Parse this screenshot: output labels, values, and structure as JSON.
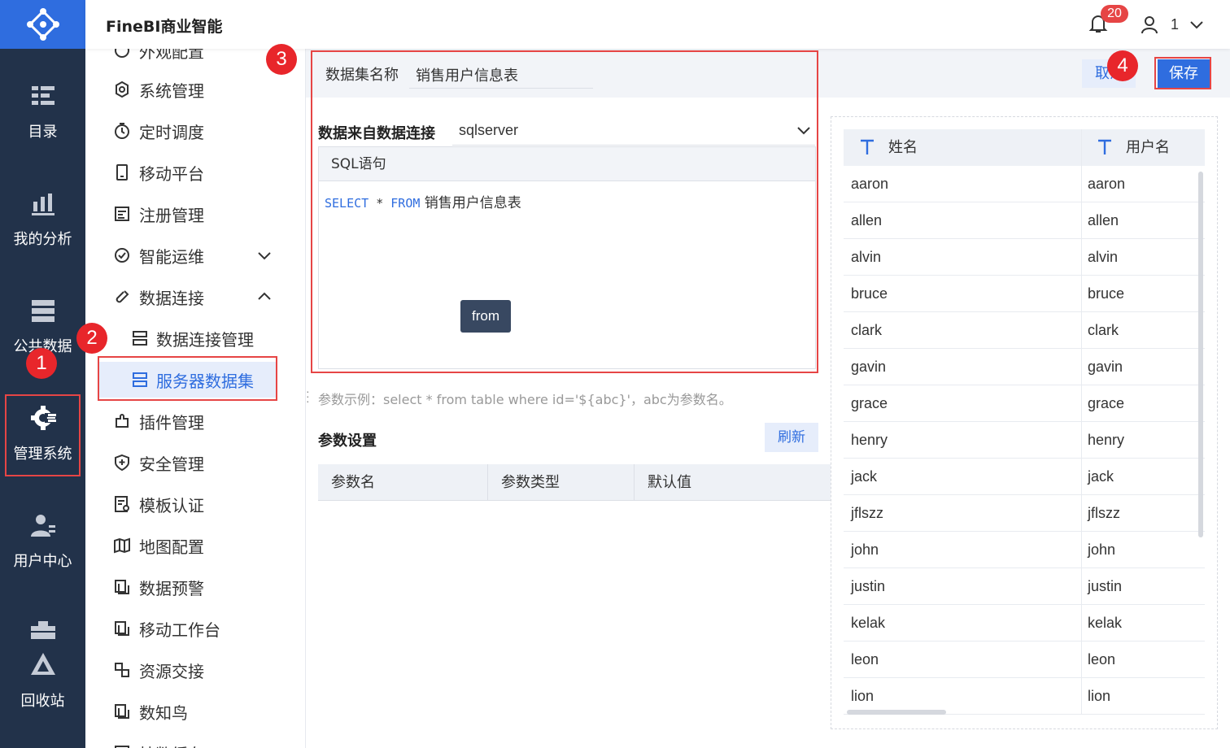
{
  "app": {
    "title": "FineBI商业智能"
  },
  "header": {
    "notification_count": "20",
    "user_name": "1"
  },
  "rail": {
    "items": [
      {
        "label": "目录",
        "icon": "catalog-icon"
      },
      {
        "label": "我的分析",
        "icon": "analysis-icon"
      },
      {
        "label": "公共数据",
        "icon": "public-data-icon"
      },
      {
        "label": "管理系统",
        "icon": "gear-icon",
        "active": true
      },
      {
        "label": "用户中心",
        "icon": "user-center-icon"
      },
      {
        "label": "",
        "icon": "toolbox-icon"
      },
      {
        "label": "回收站",
        "icon": "recycle-icon"
      }
    ]
  },
  "subnav": {
    "items": [
      {
        "label": "外观配置",
        "icon": "appearance-icon"
      },
      {
        "label": "系统管理",
        "icon": "settings-icon"
      },
      {
        "label": "定时调度",
        "icon": "timer-icon"
      },
      {
        "label": "移动平台",
        "icon": "mobile-icon"
      },
      {
        "label": "注册管理",
        "icon": "register-icon"
      },
      {
        "label": "智能运维",
        "icon": "ops-icon",
        "chevron": "down"
      },
      {
        "label": "数据连接",
        "icon": "link-icon",
        "chevron": "up"
      },
      {
        "label": "数据连接管理",
        "icon": "database-icon",
        "sub": true
      },
      {
        "label": "服务器数据集",
        "icon": "database-icon",
        "sub": true,
        "active": true
      },
      {
        "label": "插件管理",
        "icon": "plugin-icon"
      },
      {
        "label": "安全管理",
        "icon": "shield-icon"
      },
      {
        "label": "模板认证",
        "icon": "certificate-icon"
      },
      {
        "label": "地图配置",
        "icon": "map-icon"
      },
      {
        "label": "数据预警",
        "icon": "copy-icon"
      },
      {
        "label": "移动工作台",
        "icon": "copy-icon"
      },
      {
        "label": "资源交接",
        "icon": "exchange-icon"
      },
      {
        "label": "数知鸟",
        "icon": "copy-icon"
      },
      {
        "label": "抽数缓存",
        "icon": "cache-icon"
      }
    ]
  },
  "editor": {
    "name_label": "数据集名称",
    "name_value": "销售用户信息表",
    "cancel_label": "取消",
    "save_label": "保存",
    "connection_label": "数据来自数据连接",
    "connection_value": "sqlserver",
    "sql_header": "SQL语句",
    "sql": {
      "kw1": "SELECT",
      "star": " * ",
      "kw2": "FROM",
      "table": " 销售用户信息表"
    },
    "tooltip": "from",
    "hint": "参数示例：select * from table where id='${abc}'，abc为参数名。",
    "param_title": "参数设置",
    "refresh_label": "刷新",
    "param_columns": [
      "参数名",
      "参数类型",
      "默认值"
    ]
  },
  "preview": {
    "columns": [
      "姓名",
      "用户名"
    ],
    "rows": [
      [
        "aaron",
        "aaron"
      ],
      [
        "allen",
        "allen"
      ],
      [
        "alvin",
        "alvin"
      ],
      [
        "bruce",
        "bruce"
      ],
      [
        "clark",
        "clark"
      ],
      [
        "gavin",
        "gavin"
      ],
      [
        "grace",
        "grace"
      ],
      [
        "henry",
        "henry"
      ],
      [
        "jack",
        "jack"
      ],
      [
        "jflszz",
        "jflszz"
      ],
      [
        "john",
        "john"
      ],
      [
        "justin",
        "justin"
      ],
      [
        "kelak",
        "kelak"
      ],
      [
        "leon",
        "leon"
      ],
      [
        "lion",
        "lion"
      ]
    ]
  },
  "annotations": {
    "steps": [
      "1",
      "2",
      "3",
      "4"
    ]
  },
  "colors": {
    "accent": "#2f6ddf",
    "rail": "#22324a",
    "annotation": "#e64545"
  }
}
